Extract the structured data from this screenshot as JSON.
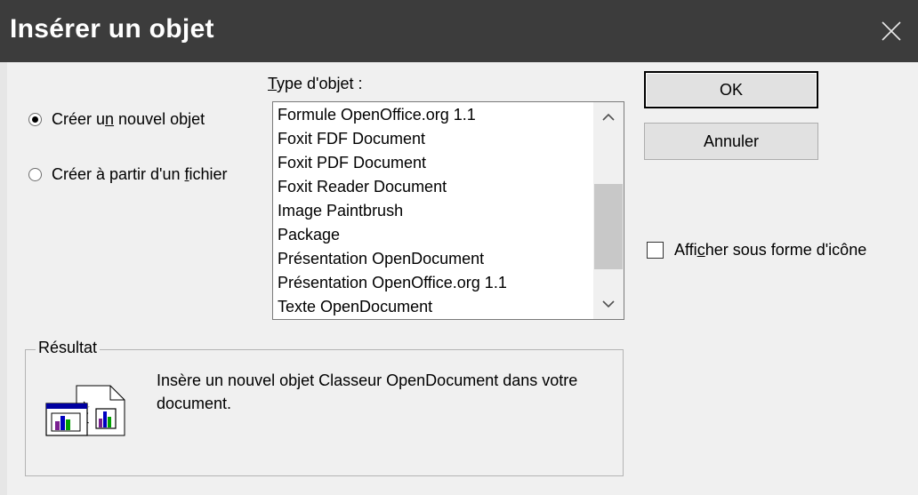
{
  "window": {
    "title": "Insérer un objet",
    "close_icon": "close-icon"
  },
  "options": {
    "create_new": {
      "label_pre": "Créer u",
      "label_key": "n",
      "label_post": " nouvel objet",
      "checked": true
    },
    "create_from_file": {
      "label_pre": "Créer à partir d'un ",
      "label_key": "f",
      "label_post": "ichier",
      "checked": false
    }
  },
  "object_type": {
    "label_key": "T",
    "label_rest": "ype d'objet :",
    "items": [
      "Formule OpenOffice.org 1.1",
      "Foxit FDF Document",
      "Foxit PDF Document",
      "Foxit Reader Document",
      "Image Paintbrush",
      "Package",
      "Présentation OpenDocument",
      "Présentation OpenOffice.org 1.1",
      "Texte OpenDocument"
    ],
    "scroll_position": 0.72
  },
  "buttons": {
    "ok": "OK",
    "cancel": "Annuler"
  },
  "display_as_icon": {
    "label_pre": "Affi",
    "label_key": "c",
    "label_post": "her sous forme d'icône",
    "checked": false
  },
  "result": {
    "legend": "Résultat",
    "text": "Insère un nouvel objet Classeur OpenDocument dans votre document.",
    "icon": "insert-object-icon"
  }
}
